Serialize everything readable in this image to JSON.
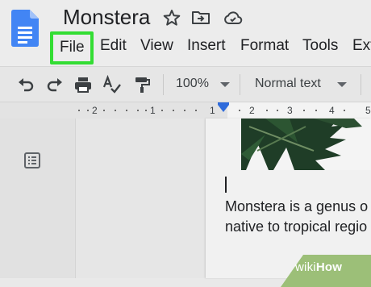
{
  "document": {
    "title": "Monstera"
  },
  "menu": {
    "file": "File",
    "edit": "Edit",
    "view": "View",
    "insert": "Insert",
    "format": "Format",
    "tools": "Tools",
    "extensions_partial": "Ext"
  },
  "toolbar": {
    "zoom": "100%",
    "style": "Normal text"
  },
  "ruler": {
    "labels": [
      "2",
      "1",
      "1",
      "2",
      "3",
      "4",
      "5"
    ]
  },
  "content": {
    "line1": "Monstera is a genus o",
    "line2": "native to tropical regio"
  },
  "watermark": {
    "wiki": "wiki",
    "how": "How"
  },
  "colors": {
    "highlight": "#33dd33",
    "docs_blue": "#4285f4",
    "ruler_marker": "#2f6bdb"
  }
}
